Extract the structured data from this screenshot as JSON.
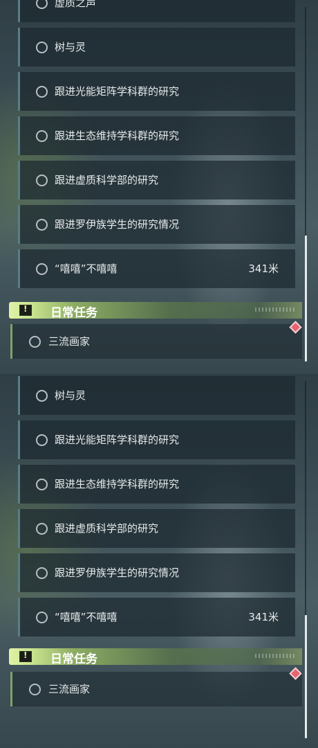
{
  "panels": [
    {
      "quests": [
        {
          "label": "虚质之声",
          "dist": ""
        },
        {
          "label": "树与灵",
          "dist": ""
        },
        {
          "label": "跟进光能矩阵学科群的研究",
          "dist": ""
        },
        {
          "label": "跟进生态维持学科群的研究",
          "dist": ""
        },
        {
          "label": "跟进虚质科学部的研究",
          "dist": ""
        },
        {
          "label": "跟进罗伊族学生的研究情况",
          "dist": ""
        },
        {
          "label": "“嘻嘻”不嘻嘻",
          "dist": "341米"
        }
      ],
      "daily": {
        "title": "日常任务",
        "quests": [
          {
            "label": "三流画家"
          }
        ]
      }
    },
    {
      "quests": [
        {
          "label": "树与灵",
          "dist": ""
        },
        {
          "label": "跟进光能矩阵学科群的研究",
          "dist": ""
        },
        {
          "label": "跟进生态维持学科群的研究",
          "dist": ""
        },
        {
          "label": "跟进虚质科学部的研究",
          "dist": ""
        },
        {
          "label": "跟进罗伊族学生的研究情况",
          "dist": ""
        },
        {
          "label": "“嘻嘻”不嘻嘻",
          "dist": "341米"
        }
      ],
      "daily": {
        "title": "日常任务",
        "quests": [
          {
            "label": "三流画家"
          }
        ]
      }
    }
  ],
  "colors": {
    "accent": "#c9e38e",
    "marker": "#e8626f",
    "quest_border": "#5a7d86"
  },
  "icons": {
    "quest_status": "circle-icon",
    "daily_header": "alert-icon",
    "tracking": "diamond-marker-icon"
  }
}
